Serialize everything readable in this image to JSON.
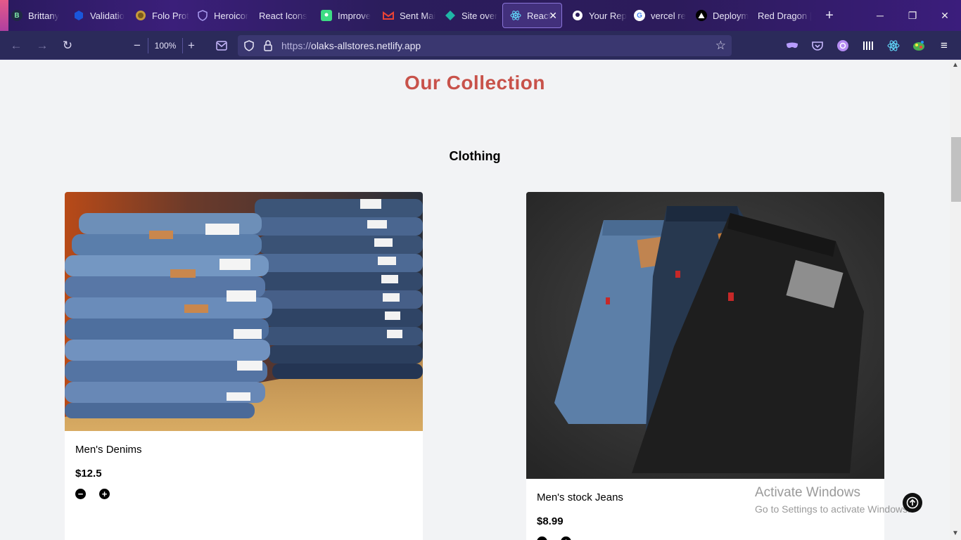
{
  "browser": {
    "tabs": [
      {
        "label": "Brittany",
        "favicon": "B",
        "color": "#1f2a44"
      },
      {
        "label": "Validatio",
        "favicon": "",
        "color": "#1a56db"
      },
      {
        "label": "Folo Prot",
        "favicon": "",
        "color": "#c79a3a"
      },
      {
        "label": "Heroicor",
        "favicon": "",
        "color": "#6b5bd6"
      },
      {
        "label": "React Icons",
        "favicon": "",
        "color": "transparent"
      },
      {
        "label": "Improve",
        "favicon": "",
        "color": "#3ddc84"
      },
      {
        "label": "Sent Mai",
        "favicon": "M",
        "color": "#ea4335"
      },
      {
        "label": "Site over",
        "favicon": "",
        "color": "#1fb6a6"
      },
      {
        "label": "React",
        "favicon": "",
        "color": "#61dafb",
        "active": true
      },
      {
        "label": "Your Rep",
        "favicon": "",
        "color": "#ffffff"
      },
      {
        "label": "vercel re",
        "favicon": "G",
        "color": "#ffffff"
      },
      {
        "label": "Deploym",
        "favicon": "",
        "color": "#000000"
      },
      {
        "label": "Red Dragon |",
        "favicon": "",
        "color": "transparent"
      }
    ],
    "zoom": "100%",
    "url_proto": "https://",
    "url_host": "olaks-allstores.netlify.app"
  },
  "page": {
    "collection_title": "Our Collection",
    "category_title": "Clothing",
    "products": [
      {
        "name": "Men's Denims",
        "price": "$12.5"
      },
      {
        "name": "Men's stock Jeans",
        "price": "$8.99"
      }
    ],
    "minus_symbol": "−",
    "plus_symbol": "+"
  },
  "watermark": {
    "line1": "Activate Windows",
    "line2": "Go to Settings to activate Windows."
  },
  "colors": {
    "accent_title": "#c8524a",
    "chrome_bg": "#2b2a5a"
  }
}
